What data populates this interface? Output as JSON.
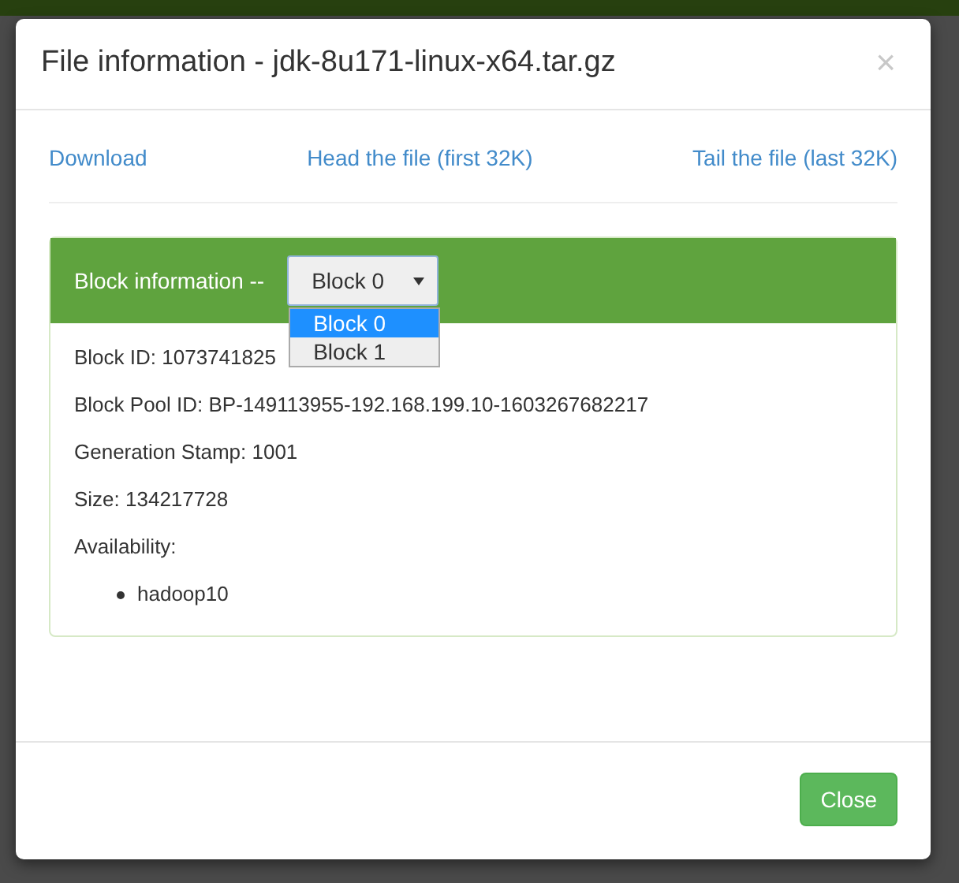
{
  "dialog": {
    "title": "File information - jdk-8u171-linux-x64.tar.gz",
    "close_icon": "×"
  },
  "links": [
    "Download",
    "Head the file (first 32K)",
    "Tail the file (last 32K)"
  ],
  "panel": {
    "heading": "Block information --",
    "select": {
      "value": "Block 0",
      "expanded": true,
      "options": [
        {
          "label": "Block 0",
          "selected": true
        },
        {
          "label": "Block 1",
          "selected": false
        }
      ]
    },
    "fields": [
      "Block ID: 1073741825",
      "Block Pool ID: BP-149113955-192.168.199.10-1603267682217",
      "Generation Stamp: 1001",
      "Size: 134217728",
      "Availability:"
    ],
    "hosts": [
      "hadoop10"
    ]
  },
  "footer": {
    "button": "Close"
  }
}
